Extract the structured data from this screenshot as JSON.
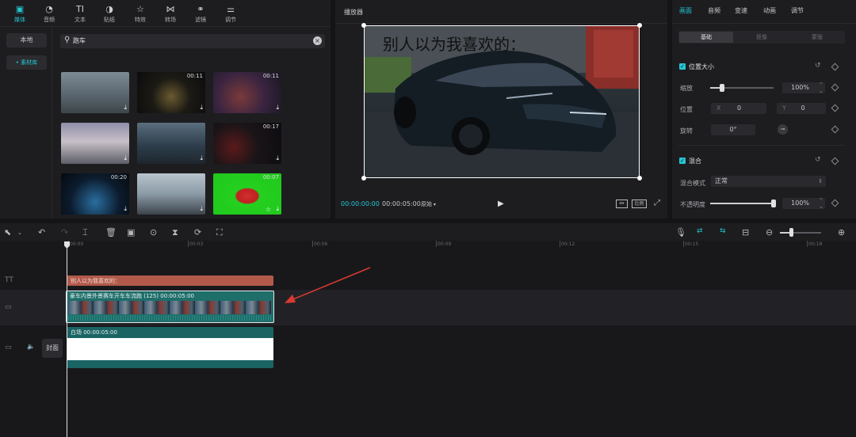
{
  "media_tabs": [
    {
      "label": "媒体",
      "icon": "media-icon",
      "glyph": "▣",
      "active": true
    },
    {
      "label": "音频",
      "icon": "audio-icon",
      "glyph": "◔",
      "active": false
    },
    {
      "label": "文本",
      "icon": "text-icon",
      "glyph": "TI",
      "active": false
    },
    {
      "label": "贴纸",
      "icon": "sticker-icon",
      "glyph": "◑",
      "active": false
    },
    {
      "label": "特效",
      "icon": "effects-icon",
      "glyph": "☆",
      "active": false
    },
    {
      "label": "转场",
      "icon": "transition-icon",
      "glyph": "⋈",
      "active": false
    },
    {
      "label": "滤镜",
      "icon": "filter-icon",
      "glyph": "⚭",
      "active": false
    },
    {
      "label": "调节",
      "icon": "adjust-icon",
      "glyph": "⚌",
      "active": false
    }
  ],
  "sidebar": {
    "local": "本地",
    "library": "• 素材库"
  },
  "search": {
    "value": "跑车"
  },
  "thumbnails": [
    {
      "duration": "",
      "bg": "linear-gradient(180deg,#7d8c94 0%,#5a6670 55%,#3d4548 100%)"
    },
    {
      "duration": "00:11",
      "bg": "radial-gradient(circle at 50% 60%,#6a5a30 0%,#1c1a14 45%,#0b0b0c 100%)"
    },
    {
      "duration": "00:11",
      "bg": "radial-gradient(circle at 40% 60%,#7a3a3a 0%,#3a2440 50%,#181822 100%)"
    },
    {
      "duration": "",
      "bg": "linear-gradient(180deg,#8e8ea8 0%,#c8c0c8 45%,#5c5e68 100%)"
    },
    {
      "duration": "",
      "bg": "linear-gradient(180deg,#5a6e7e 0%,#2e3e4c 55%,#1e262e 100%)"
    },
    {
      "duration": "00:17",
      "bg": "radial-gradient(circle at 30% 60%,#5a1a1a 0%,#1a1418 45%,#0c0c10 100%)"
    },
    {
      "duration": "00:20",
      "bg": "radial-gradient(circle at 50% 70%,#2a6ea0 0%,#0c1c2e 55%,#060a10 100%)"
    },
    {
      "duration": "",
      "bg": "linear-gradient(180deg,#b8c4cc 0%,#8a9aa6 50%,#3c444a 100%)"
    },
    {
      "duration": "00:07",
      "bg": "radial-gradient(ellipse at 50% 55%,#d03030 0%,#c02020 22%,#24d020 26%,#20c81c 100%)"
    }
  ],
  "player": {
    "title": "播放器",
    "caption": "别人以为我喜欢的：",
    "time_current": "00:00:00:00",
    "time_total": "00:00:05:00",
    "ratio_label": "原始",
    "ratio_btn": "比例"
  },
  "inspector": {
    "tabs": [
      "画面",
      "音频",
      "变速",
      "动画",
      "调节"
    ],
    "subtabs": [
      "基础",
      "抠像",
      "蒙版"
    ],
    "position_size": {
      "title": "位置大小",
      "scale_label": "缩放",
      "scale_value": "100%",
      "pos_label": "位置",
      "x_label": "X",
      "x_value": "0",
      "y_label": "Y",
      "y_value": "0",
      "rotate_label": "旋转",
      "rotate_value": "0°"
    },
    "blend": {
      "title": "混合",
      "mode_label": "混合模式",
      "mode_value": "正常",
      "opacity_label": "不透明度",
      "opacity_value": "100%"
    }
  },
  "timeline": {
    "ticks": [
      "00:00",
      "00:03",
      "00:06",
      "00:09",
      "00:12",
      "00:15",
      "00:18"
    ],
    "text_clip": "别人以为我喜欢的：",
    "video_clip": "豪车内景外景赛车开车车流跑  (125)   00:00:05:00",
    "audio_clip": "白场   00:00:05:00",
    "cover_label": "封面"
  },
  "colors": {
    "accent": "#24c6d3",
    "text_clip": "#b25a4a",
    "video_clip": "#1e6e6a",
    "audio_clip": "#1a6464",
    "arrow": "#d83a32"
  }
}
